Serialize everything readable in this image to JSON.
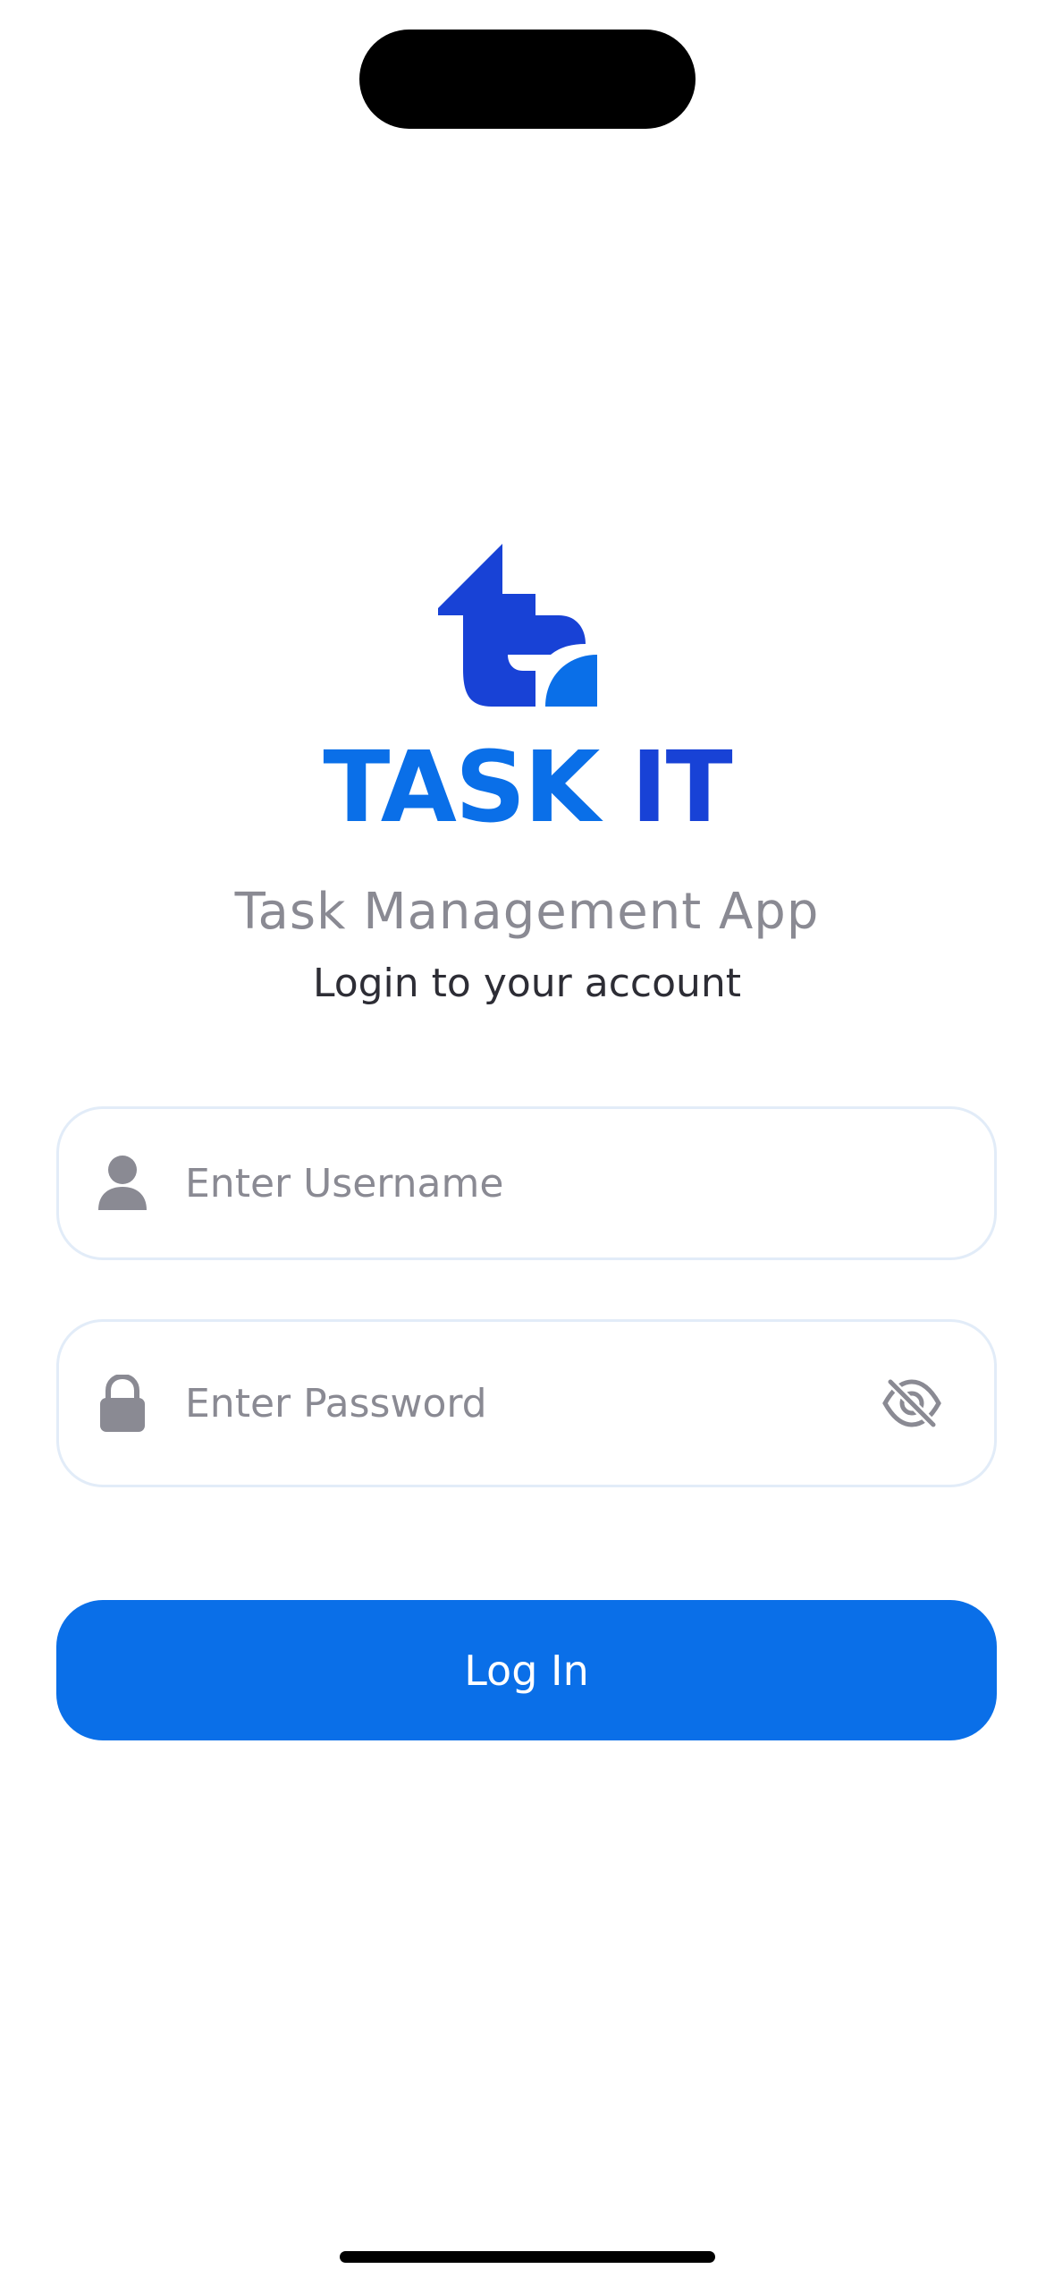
{
  "brand": {
    "name_part1": "TASK",
    "name_part2": "IT",
    "logo_icon": "task-it-logo",
    "primary_color": "#0a6fe8",
    "secondary_color": "#1842d6"
  },
  "header": {
    "app_title": "Task Management App",
    "subtitle": "Login to your account"
  },
  "form": {
    "username": {
      "placeholder": "Enter Username",
      "value": "",
      "icon": "person-icon"
    },
    "password": {
      "placeholder": "Enter Password",
      "value": "",
      "icon": "lock-icon",
      "toggle_icon": "eye-slash-icon"
    },
    "login_label": "Log In"
  },
  "colors": {
    "placeholder": "#8a8a93",
    "field_border": "#e2ecf8",
    "button": "#0a6fe8"
  }
}
